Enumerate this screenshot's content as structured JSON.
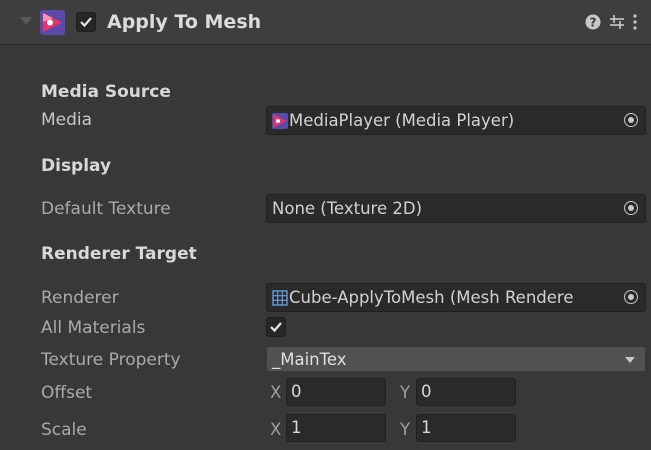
{
  "header": {
    "title": "Apply To Mesh",
    "enabled": true,
    "icons": [
      "foldout-arrow-icon",
      "avpro-logo-icon",
      "help-icon",
      "presets-icon",
      "kebab-menu-icon"
    ]
  },
  "sections": {
    "media_source": "Media Source",
    "display": "Display",
    "renderer_target": "Renderer Target"
  },
  "fields": {
    "media": {
      "label": "Media",
      "value": "MediaPlayer (Media Player)",
      "icon": "media-player-icon"
    },
    "default_texture": {
      "label": "Default Texture",
      "value": "None (Texture 2D)"
    },
    "renderer": {
      "label": "Renderer",
      "value": "Cube-ApplyToMesh (Mesh Rendere",
      "icon": "mesh-renderer-icon"
    },
    "all_materials": {
      "label": "All Materials",
      "checked": true
    },
    "texture_property": {
      "label": "Texture Property",
      "value": "_MainTex"
    },
    "offset": {
      "label": "Offset",
      "x_label": "X",
      "x": "0",
      "y_label": "Y",
      "y": "0"
    },
    "scale": {
      "label": "Scale",
      "x_label": "X",
      "x": "1",
      "y_label": "Y",
      "y": "1"
    }
  },
  "colors": {
    "background": "#383838",
    "header": "#3e3e3e",
    "field": "#2a2a2a",
    "accent_pink": "#e8336b"
  }
}
